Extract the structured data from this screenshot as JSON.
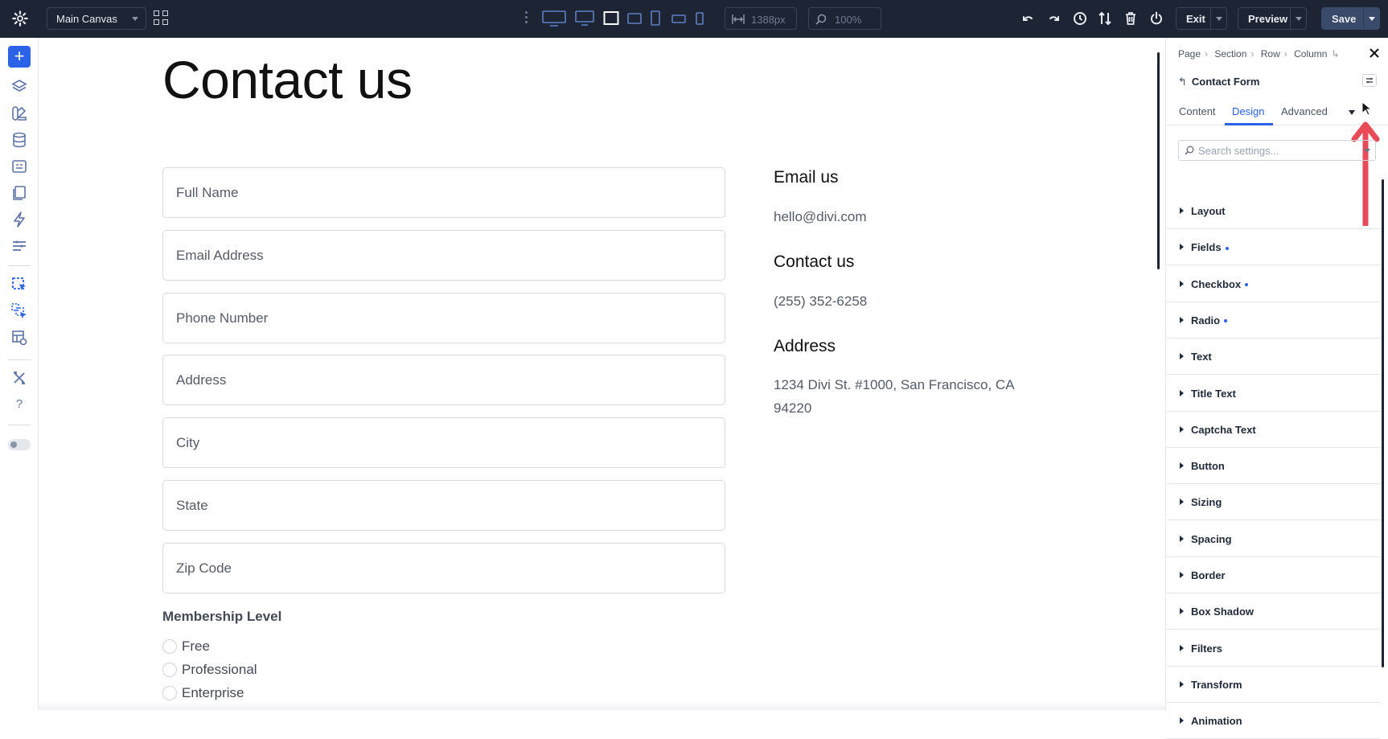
{
  "topbar": {
    "canvas_label": "Main Canvas",
    "width_value": "1388px",
    "zoom_value": "100%",
    "exit_label": "Exit",
    "preview_label": "Preview",
    "save_label": "Save"
  },
  "page": {
    "title": "Contact us",
    "fields": [
      "Full Name",
      "Email Address",
      "Phone Number",
      "Address",
      "City",
      "State",
      "Zip Code"
    ],
    "membership_label": "Membership Level",
    "membership_options": [
      "Free",
      "Professional",
      "Enterprise"
    ],
    "info": {
      "email_heading": "Email us",
      "email_value": "hello@divi.com",
      "phone_heading": "Contact us",
      "phone_value": "(255) 352-6258",
      "address_heading": "Address",
      "address_line1": "1234 Divi St. #1000, San Francisco, CA",
      "address_line2": "94220"
    }
  },
  "panel": {
    "breadcrumbs": [
      "Page",
      "Section",
      "Row",
      "Column"
    ],
    "element_title": "Contact Form",
    "tabs": [
      "Content",
      "Design",
      "Advanced"
    ],
    "active_tab": "Design",
    "search_placeholder": "Search settings...",
    "groups": [
      {
        "label": "Layout",
        "modified": false
      },
      {
        "label": "Fields",
        "modified": true
      },
      {
        "label": "Checkbox",
        "modified": true
      },
      {
        "label": "Radio",
        "modified": true
      },
      {
        "label": "Text",
        "modified": false
      },
      {
        "label": "Title Text",
        "modified": false
      },
      {
        "label": "Captcha Text",
        "modified": false
      },
      {
        "label": "Button",
        "modified": false
      },
      {
        "label": "Sizing",
        "modified": false
      },
      {
        "label": "Spacing",
        "modified": false
      },
      {
        "label": "Border",
        "modified": false
      },
      {
        "label": "Box Shadow",
        "modified": false
      },
      {
        "label": "Filters",
        "modified": false
      },
      {
        "label": "Transform",
        "modified": false
      },
      {
        "label": "Animation",
        "modified": false
      }
    ]
  },
  "colors": {
    "topbar_bg": "#1d2534",
    "accent": "#2b62e8",
    "annotation_arrow": "#e84a57"
  }
}
